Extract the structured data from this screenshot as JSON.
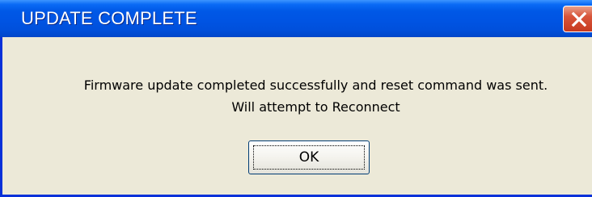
{
  "dialog": {
    "title": "UPDATE COMPLETE",
    "message_line1": "Firmware update completed successfully and reset command was sent.",
    "message_line2": "Will attempt to Reconnect",
    "ok_label": "OK",
    "close_icon": "close-icon"
  },
  "colors": {
    "title_bar": "#0054e3",
    "dialog_background": "#ece9d8",
    "close_button": "#d8553a"
  }
}
